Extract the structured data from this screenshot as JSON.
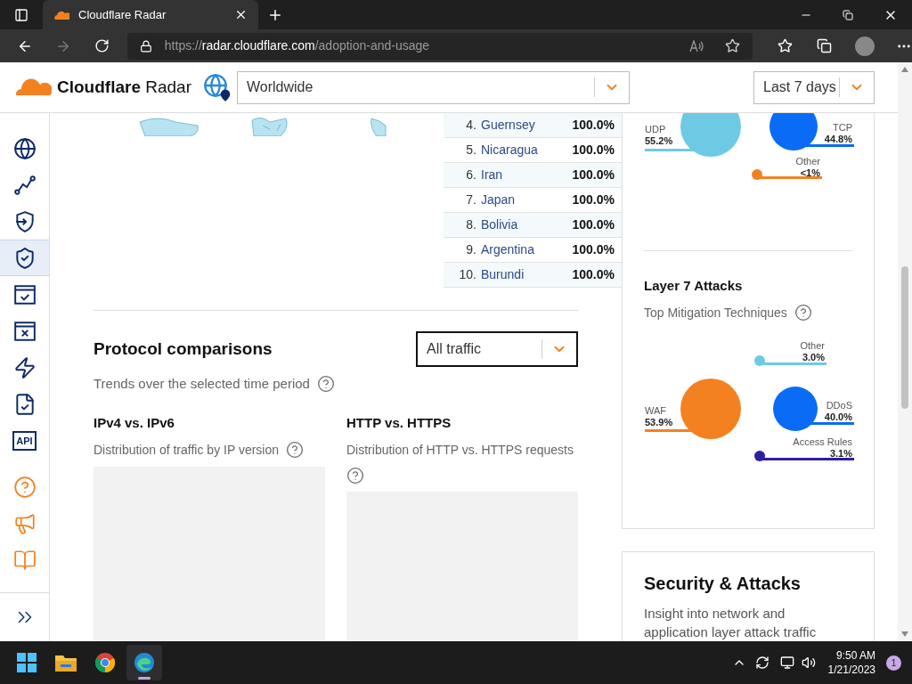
{
  "browser": {
    "tab_title": "Cloudflare Radar",
    "url": {
      "scheme": "https://",
      "host": "radar.cloudflare.com",
      "path": "/adoption-and-usage"
    }
  },
  "header": {
    "brand": "Cloudflare",
    "product": "Radar",
    "location": {
      "value": "Worldwide"
    },
    "period": {
      "value": "Last 7 days"
    }
  },
  "sidebar": {
    "nav_items": [
      {
        "selected": false
      },
      {
        "selected": false
      },
      {
        "selected": false
      },
      {
        "selected": true
      },
      {
        "selected": false
      },
      {
        "selected": false
      },
      {
        "selected": false
      },
      {
        "selected": false
      },
      {
        "selected": false,
        "label": "API"
      }
    ]
  },
  "ranking": {
    "rows": [
      {
        "rank": "4.",
        "country": "Guernsey",
        "share": "100.0%"
      },
      {
        "rank": "5.",
        "country": "Nicaragua",
        "share": "100.0%"
      },
      {
        "rank": "6.",
        "country": "Iran",
        "share": "100.0%"
      },
      {
        "rank": "7.",
        "country": "Japan",
        "share": "100.0%"
      },
      {
        "rank": "8.",
        "country": "Bolivia",
        "share": "100.0%"
      },
      {
        "rank": "9.",
        "country": "Argentina",
        "share": "100.0%"
      },
      {
        "rank": "10.",
        "country": "Burundi",
        "share": "100.0%"
      }
    ]
  },
  "protocol_comparisons": {
    "title": "Protocol comparisons",
    "subtitle": "Trends over the selected time period",
    "filter": {
      "value": "All traffic"
    },
    "panels": [
      {
        "title": "IPv4 vs. IPv6",
        "description": "Distribution of traffic by IP version",
        "loading": true
      },
      {
        "title": "HTTP vs. HTTPS",
        "description": "Distribution of HTTP vs. HTTPS requests",
        "loading": true
      }
    ]
  },
  "transport_chart": {
    "bubbles": [
      {
        "label": "UDP",
        "value": "55.2%",
        "color": "#6ecae4"
      },
      {
        "label": "TCP",
        "value": "44.8%",
        "color": "#0a6cf5"
      },
      {
        "label": "Other",
        "value": "<1%",
        "color": "#f48120"
      }
    ]
  },
  "layer7": {
    "title": "Layer 7 Attacks",
    "subtitle": "Top Mitigation Techniques",
    "bubbles": [
      {
        "label": "Other",
        "value": "3.0%",
        "color": "#6ecae4"
      },
      {
        "label": "WAF",
        "value": "53.9%",
        "color": "#f48120"
      },
      {
        "label": "DDoS",
        "value": "40.0%",
        "color": "#0a6cf5"
      },
      {
        "label": "Access Rules",
        "value": "3.1%",
        "color": "#2d1fa3"
      }
    ]
  },
  "security_card": {
    "title": "Security & Attacks",
    "description": "Insight into network and application layer attack traffic"
  },
  "taskbar": {
    "apps": [
      {
        "selected": false
      },
      {
        "selected": false
      },
      {
        "selected": false
      },
      {
        "selected": true
      }
    ],
    "time": "9:50 AM",
    "date": "1/21/2023",
    "notification_count": "1"
  }
}
